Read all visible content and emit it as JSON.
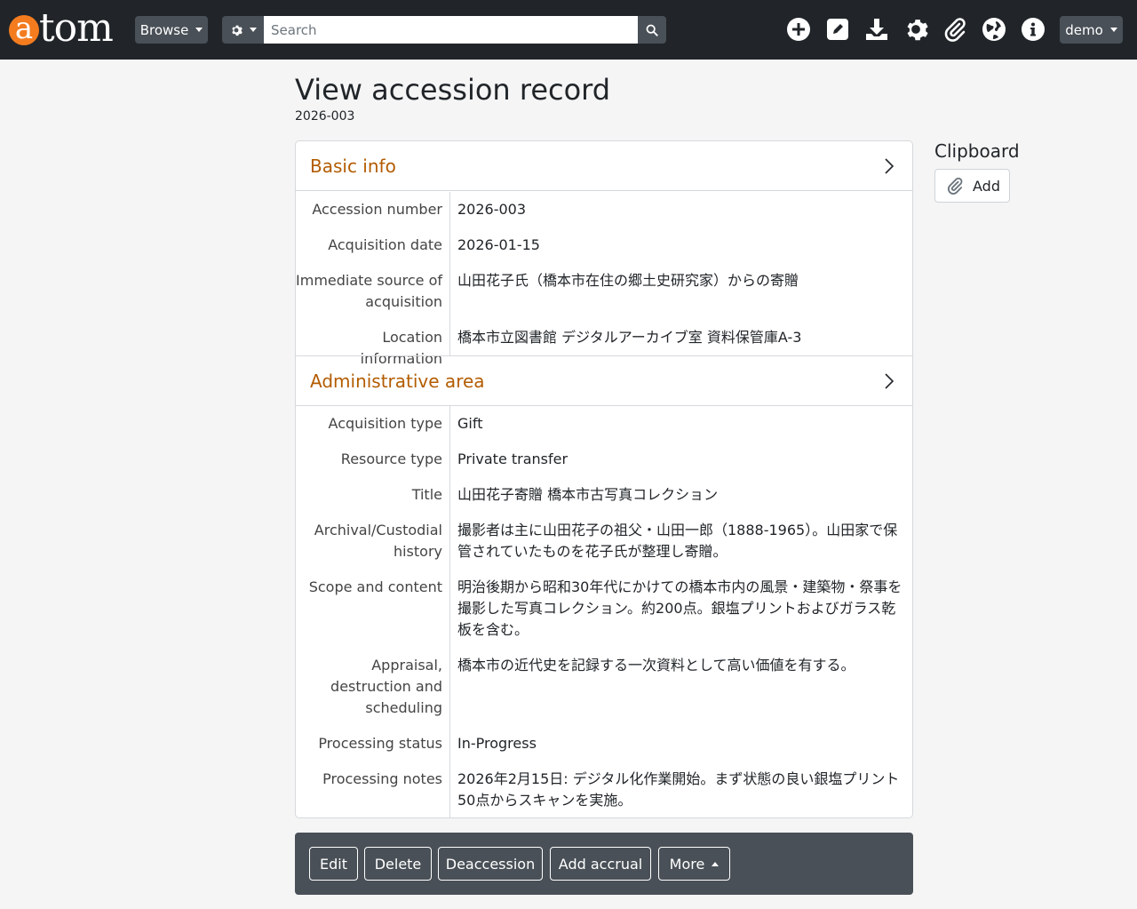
{
  "navbar": {
    "logo_letter": "a",
    "logo_rest": "tom",
    "browse_label": "Browse",
    "search_placeholder": "Search",
    "user_label": "demo",
    "icons": [
      "add-icon",
      "edit-icon",
      "download-icon",
      "gear-icon",
      "paperclip-icon",
      "globe-icon",
      "info-icon"
    ]
  },
  "page": {
    "title": "View accession record",
    "subtitle": "2026-003"
  },
  "sections": {
    "basic": {
      "heading": "Basic info",
      "rows": [
        {
          "label": "Accession number",
          "value": "2026-003"
        },
        {
          "label": "Acquisition date",
          "value": "2026-01-15"
        },
        {
          "label": "Immediate source of acquisition",
          "value": "山田花子氏（橋本市在住の郷土史研究家）からの寄贈"
        },
        {
          "label": "Location information",
          "value": "橋本市立図書館 デジタルアーカイブ室 資料保管庫A-3"
        }
      ]
    },
    "admin": {
      "heading": "Administrative area",
      "rows": [
        {
          "label": "Acquisition type",
          "value": "Gift"
        },
        {
          "label": "Resource type",
          "value": "Private transfer"
        },
        {
          "label": "Title",
          "value": "山田花子寄贈 橋本市古写真コレクション"
        },
        {
          "label": "Archival/Custodial history",
          "value": "撮影者は主に山田花子の祖父・山田一郎（1888-1965）。山田家で保管されていたものを花子氏が整理し寄贈。"
        },
        {
          "label": "Scope and content",
          "value": "明治後期から昭和30年代にかけての橋本市内の風景・建築物・祭事を撮影した写真コレクション。約200点。銀塩プリントおよびガラス乾板を含む。"
        },
        {
          "label": "Appraisal, destruction and scheduling",
          "value": "橋本市の近代史を記録する一次資料として高い価値を有する。"
        },
        {
          "label": "Processing status",
          "value": "In-Progress"
        },
        {
          "label": "Processing notes",
          "value": "2026年2月15日: デジタル化作業開始。まず状態の良い銀塩プリント50点からスキャンを実施。"
        }
      ]
    }
  },
  "clipboard": {
    "title": "Clipboard",
    "add_label": "Add"
  },
  "actions": {
    "edit": "Edit",
    "delete": "Delete",
    "deaccession": "Deaccession",
    "add_accrual": "Add accrual",
    "more": "More"
  }
}
